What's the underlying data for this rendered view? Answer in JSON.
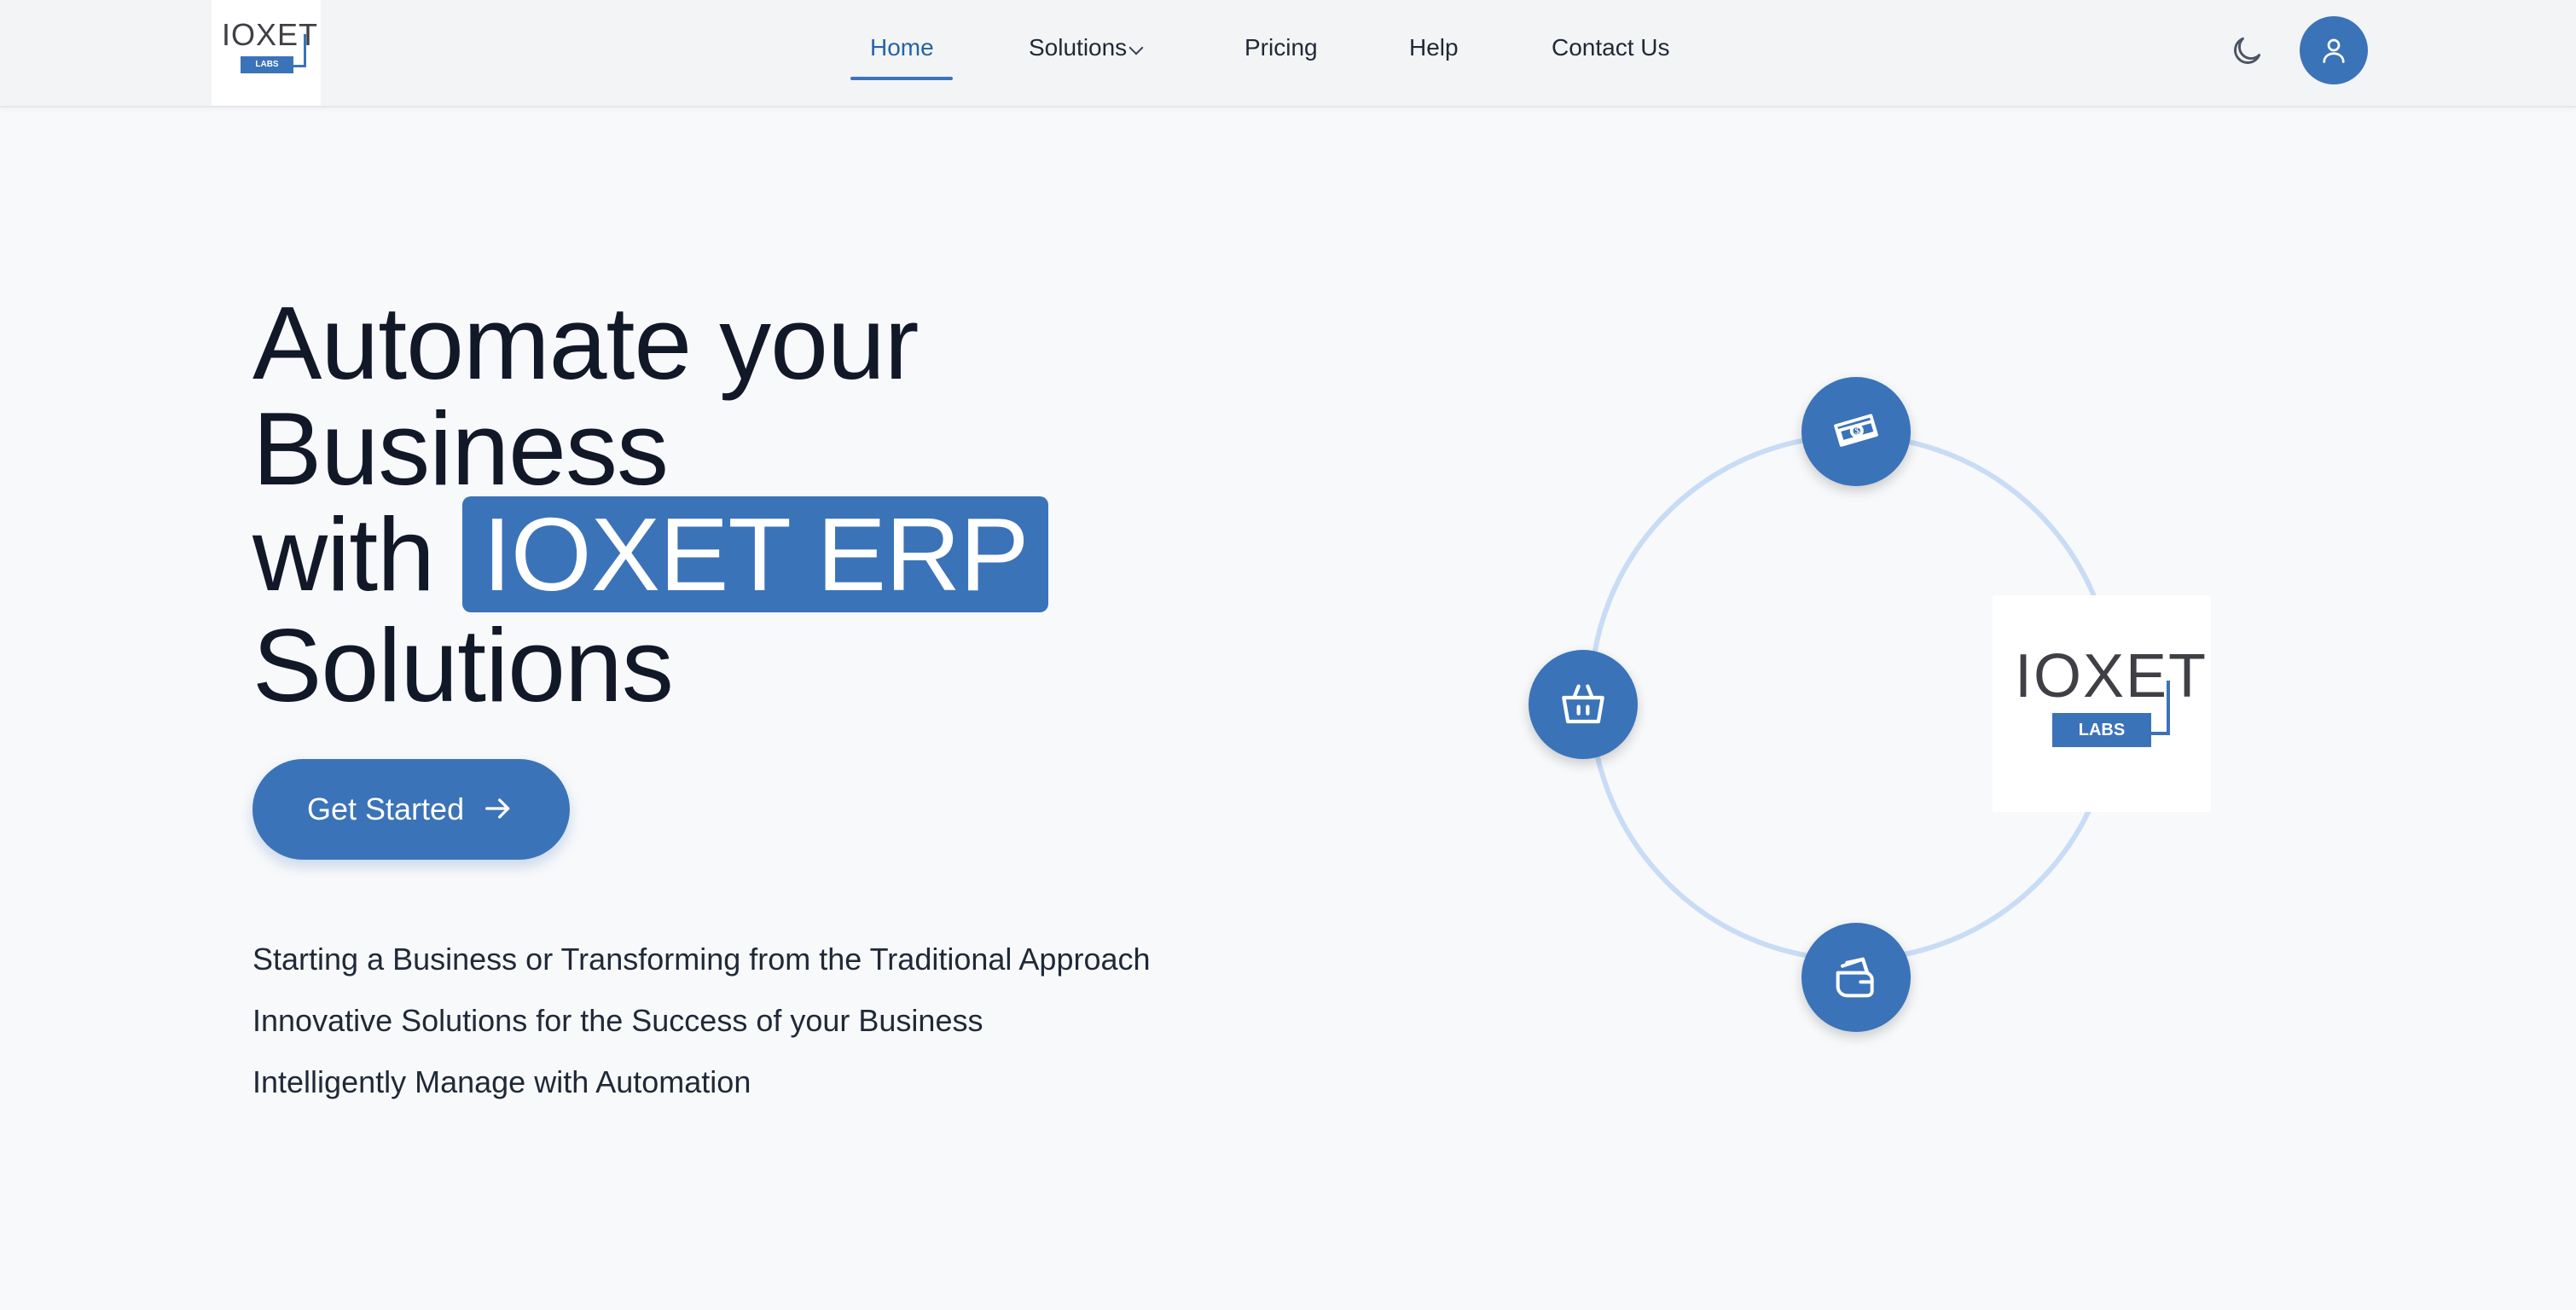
{
  "header": {
    "logo": {
      "name": "IOXET",
      "sub": "LABS"
    },
    "nav": [
      {
        "label": "Home",
        "active": true
      },
      {
        "label": "Solutions",
        "has_dropdown": true
      },
      {
        "label": "Pricing"
      },
      {
        "label": "Help"
      },
      {
        "label": "Contact Us"
      }
    ],
    "theme_toggle_icon": "moon-icon",
    "user_icon": "user-icon"
  },
  "hero": {
    "title_line1": "Automate your",
    "title_line2": "Business",
    "title_with": "with",
    "title_highlight": "IOXET ERP",
    "title_line4": "Solutions",
    "cta_label": "Get Started",
    "taglines": [
      "Starting a Business or Transforming from the Traditional Approach",
      "Innovative Solutions for the Success of your Business",
      "Intelligently Manage with Automation"
    ]
  },
  "diagram": {
    "nodes": [
      "money-icon",
      "basket-icon",
      "wallet-icon"
    ],
    "center_logo": {
      "name": "IOXET",
      "sub": "LABS"
    }
  },
  "colors": {
    "primary": "#3b73b9",
    "ring": "#c9dcf5",
    "background": "#f8f9fb"
  }
}
